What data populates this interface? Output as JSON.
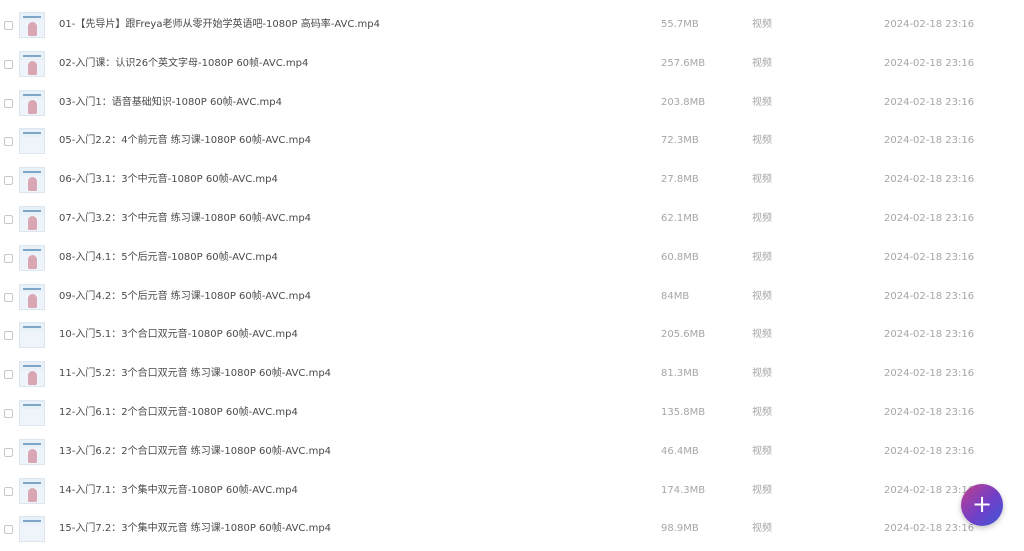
{
  "files": [
    {
      "name": "01-【先导片】跟Freya老师从零开始学英语吧-1080P 高码率-AVC.mp4",
      "size": "55.7MB",
      "type": "视频",
      "date": "2024-02-18 23:16"
    },
    {
      "name": "02-入门课：认识26个英文字母-1080P 60帧-AVC.mp4",
      "size": "257.6MB",
      "type": "视频",
      "date": "2024-02-18 23:16"
    },
    {
      "name": "03-入门1：语音基础知识-1080P 60帧-AVC.mp4",
      "size": "203.8MB",
      "type": "视频",
      "date": "2024-02-18 23:16"
    },
    {
      "name": "05-入门2.2：4个前元音 练习课-1080P 60帧-AVC.mp4",
      "size": "72.3MB",
      "type": "视频",
      "date": "2024-02-18 23:16"
    },
    {
      "name": "06-入门3.1：3个中元音-1080P 60帧-AVC.mp4",
      "size": "27.8MB",
      "type": "视频",
      "date": "2024-02-18 23:16"
    },
    {
      "name": "07-入门3.2：3个中元音 练习课-1080P 60帧-AVC.mp4",
      "size": "62.1MB",
      "type": "视频",
      "date": "2024-02-18 23:16"
    },
    {
      "name": "08-入门4.1：5个后元音-1080P 60帧-AVC.mp4",
      "size": "60.8MB",
      "type": "视频",
      "date": "2024-02-18 23:16"
    },
    {
      "name": "09-入门4.2：5个后元音 练习课-1080P 60帧-AVC.mp4",
      "size": "84MB",
      "type": "视频",
      "date": "2024-02-18 23:16"
    },
    {
      "name": "10-入门5.1：3个合口双元音-1080P 60帧-AVC.mp4",
      "size": "205.6MB",
      "type": "视频",
      "date": "2024-02-18 23:16"
    },
    {
      "name": "11-入门5.2：3个合口双元音 练习课-1080P 60帧-AVC.mp4",
      "size": "81.3MB",
      "type": "视频",
      "date": "2024-02-18 23:16"
    },
    {
      "name": "12-入门6.1：2个合口双元音-1080P 60帧-AVC.mp4",
      "size": "135.8MB",
      "type": "视频",
      "date": "2024-02-18 23:16"
    },
    {
      "name": "13-入门6.2：2个合口双元音 练习课-1080P 60帧-AVC.mp4",
      "size": "46.4MB",
      "type": "视频",
      "date": "2024-02-18 23:16"
    },
    {
      "name": "14-入门7.1：3个集中双元音-1080P 60帧-AVC.mp4",
      "size": "174.3MB",
      "type": "视频",
      "date": "2024-02-18 23:16"
    },
    {
      "name": "15-入门7.2：3个集中双元音 练习课-1080P 60帧-AVC.mp4",
      "size": "98.9MB",
      "type": "视频",
      "date": "2024-02-18 23:16"
    }
  ],
  "fab": {
    "icon": "plus-icon",
    "label": "+"
  }
}
